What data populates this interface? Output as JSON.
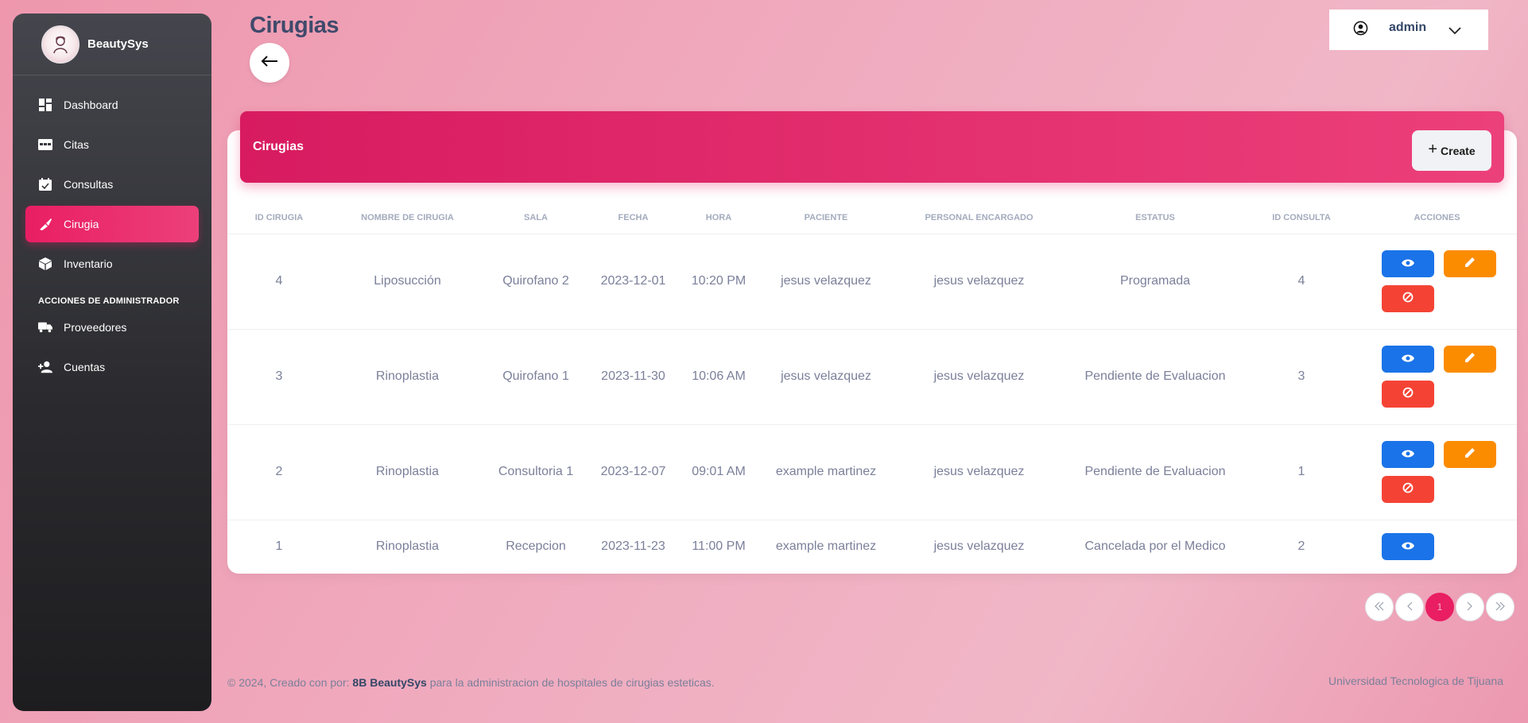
{
  "brand": {
    "name": "BeautySys"
  },
  "sidebar": {
    "items": [
      {
        "label": "Dashboard",
        "icon": "dashboard-icon"
      },
      {
        "label": "Citas",
        "icon": "calendar-view-icon"
      },
      {
        "label": "Consultas",
        "icon": "calendar-check-icon"
      },
      {
        "label": "Cirugia",
        "icon": "scalpel-icon"
      },
      {
        "label": "Inventario",
        "icon": "box-icon"
      }
    ],
    "admin_section": "ACCIONES DE ADMINISTRADOR",
    "admin_items": [
      {
        "label": "Proveedores",
        "icon": "truck-icon"
      },
      {
        "label": "Cuentas",
        "icon": "add-user-icon"
      }
    ],
    "active_index": 3
  },
  "header": {
    "title": "Cirugias",
    "user": "admin"
  },
  "card": {
    "title": "Cirugias",
    "create_label": "Create"
  },
  "table": {
    "columns": [
      "ID CIRUGIA",
      "NOMBRE DE CIRUGIA",
      "SALA",
      "FECHA",
      "HORA",
      "PACIENTE",
      "PERSONAL ENCARGADO",
      "ESTATUS",
      "ID CONSULTA",
      "ACCIONES"
    ],
    "rows": [
      {
        "id": "4",
        "nombre": "Liposucción",
        "sala": "Quirofano 2",
        "fecha": "2023-12-01",
        "hora": "10:20 PM",
        "paciente": "jesus velazquez",
        "personal": "jesus velazquez",
        "estatus": "Programada",
        "id_consulta": "4"
      },
      {
        "id": "3",
        "nombre": "Rinoplastia",
        "sala": "Quirofano 1",
        "fecha": "2023-11-30",
        "hora": "10:06 AM",
        "paciente": "jesus velazquez",
        "personal": "jesus velazquez",
        "estatus": "Pendiente de Evaluacion",
        "id_consulta": "3"
      },
      {
        "id": "2",
        "nombre": "Rinoplastia",
        "sala": "Consultoria 1",
        "fecha": "2023-12-07",
        "hora": "09:01 AM",
        "paciente": "example martinez",
        "personal": "jesus velazquez",
        "estatus": "Pendiente de Evaluacion",
        "id_consulta": "1"
      },
      {
        "id": "1",
        "nombre": "Rinoplastia",
        "sala": "Recepcion",
        "fecha": "2023-11-23",
        "hora": "11:00 PM",
        "paciente": "example martinez",
        "personal": "jesus velazquez",
        "estatus": "Cancelada por el Medico",
        "id_consulta": "2"
      }
    ]
  },
  "pagination": {
    "current": "1"
  },
  "footer": {
    "prefix": "© 2024, Creado con por: ",
    "brand": "8B BeautySys",
    "suffix": " para la administracion de hospitales de cirugias esteticas.",
    "right": "Universidad Tecnologica de Tijuana"
  },
  "colors": {
    "accent": "#e91e63",
    "view": "#1a73e8",
    "edit": "#fb8c00",
    "cancel": "#f44335"
  }
}
